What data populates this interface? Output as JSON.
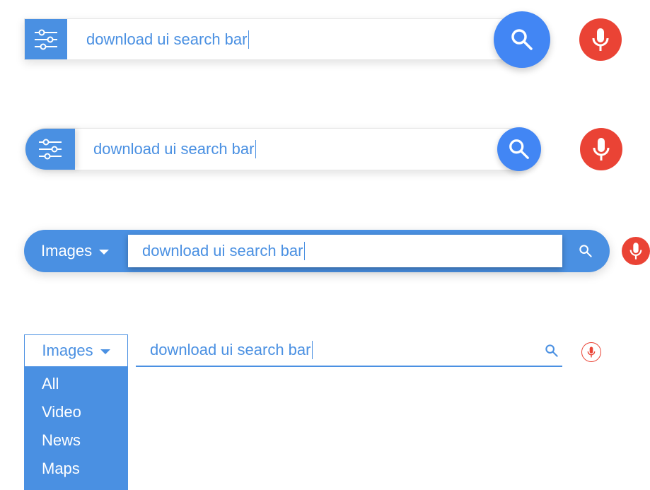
{
  "colors": {
    "accent": "#4a90e2",
    "search_button": "#4286f4",
    "mic": "#ea4335",
    "text_on_accent": "#ffffff"
  },
  "bars": [
    {
      "variant": "square-filter",
      "query": "download ui search bar",
      "filter_icon": "sliders-icon",
      "search_icon": "search-icon",
      "mic_icon": "microphone-icon"
    },
    {
      "variant": "rounded-filter",
      "query": "download ui search bar",
      "filter_icon": "sliders-icon",
      "search_icon": "search-icon",
      "mic_icon": "microphone-icon"
    },
    {
      "variant": "pill-category",
      "category": "Images",
      "query": "download ui search bar",
      "search_icon": "search-icon",
      "mic_icon": "microphone-icon"
    },
    {
      "variant": "underline-category-open",
      "category": "Images",
      "query": "download ui search bar",
      "dropdown_options": [
        "All",
        "Video",
        "News",
        "Maps"
      ],
      "search_icon": "search-icon",
      "mic_icon": "microphone-outline-icon"
    }
  ]
}
